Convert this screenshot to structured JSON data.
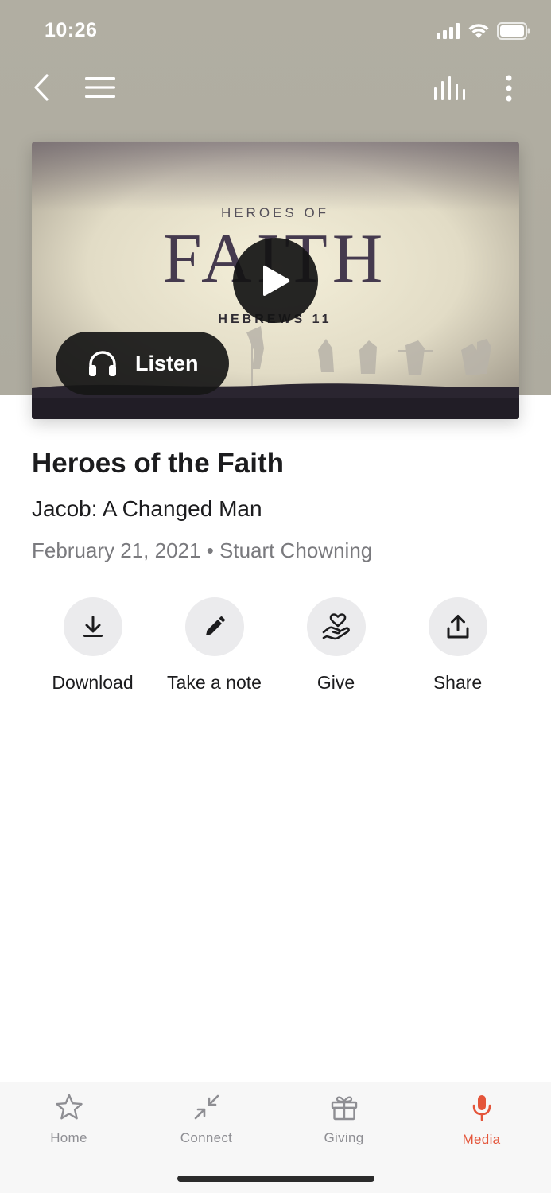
{
  "status_bar": {
    "time": "10:26"
  },
  "hero": {
    "artwork": {
      "kicker": "HEROES OF",
      "headline": "FAITH",
      "subtitle": "HEBREWS 11"
    },
    "listen_label": "Listen"
  },
  "sermon": {
    "series_title": "Heroes of the Faith",
    "title": "Jacob: A Changed Man",
    "meta": "February 21, 2021 • Stuart Chowning"
  },
  "actions": [
    {
      "label": "Download",
      "icon": "download-icon"
    },
    {
      "label": "Take a note",
      "icon": "pencil-icon"
    },
    {
      "label": "Give",
      "icon": "give-heart-hand-icon"
    },
    {
      "label": "Share",
      "icon": "share-icon"
    }
  ],
  "tab_bar": {
    "tabs": [
      {
        "label": "Home",
        "icon": "star-icon"
      },
      {
        "label": "Connect",
        "icon": "connect-arrows-icon"
      },
      {
        "label": "Giving",
        "icon": "gift-icon"
      },
      {
        "label": "Media",
        "icon": "microphone-icon",
        "active": true
      }
    ]
  },
  "colors": {
    "accent": "#e4553a",
    "header_bg": "#aeab9f",
    "action_bg": "#ebebed"
  }
}
